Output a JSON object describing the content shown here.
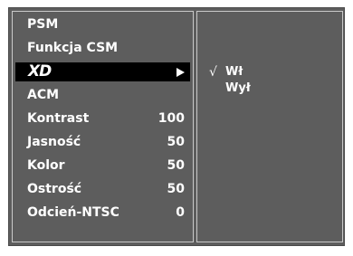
{
  "menu": {
    "items": [
      {
        "label": "PSM",
        "value": ""
      },
      {
        "label": "Funkcja CSM",
        "value": ""
      },
      {
        "label": "XD",
        "value": ""
      },
      {
        "label": "ACM",
        "value": ""
      },
      {
        "label": "Kontrast",
        "value": "100"
      },
      {
        "label": "Jasność",
        "value": "50"
      },
      {
        "label": "Kolor",
        "value": "50"
      },
      {
        "label": "Ostrość",
        "value": "50"
      },
      {
        "label": "Odcień-NTSC",
        "value": "0"
      }
    ],
    "selected_index": 2
  },
  "submenu": {
    "check_mark": "√",
    "options": [
      {
        "label": "Wł"
      },
      {
        "label": "Wył"
      }
    ]
  },
  "colors": {
    "panel": "#5d5d5d",
    "selected_bg": "#000000",
    "text": "#ffffff",
    "border": "#c9c9c9"
  },
  "icons": {
    "submenu_arrow": "right-triangle"
  }
}
